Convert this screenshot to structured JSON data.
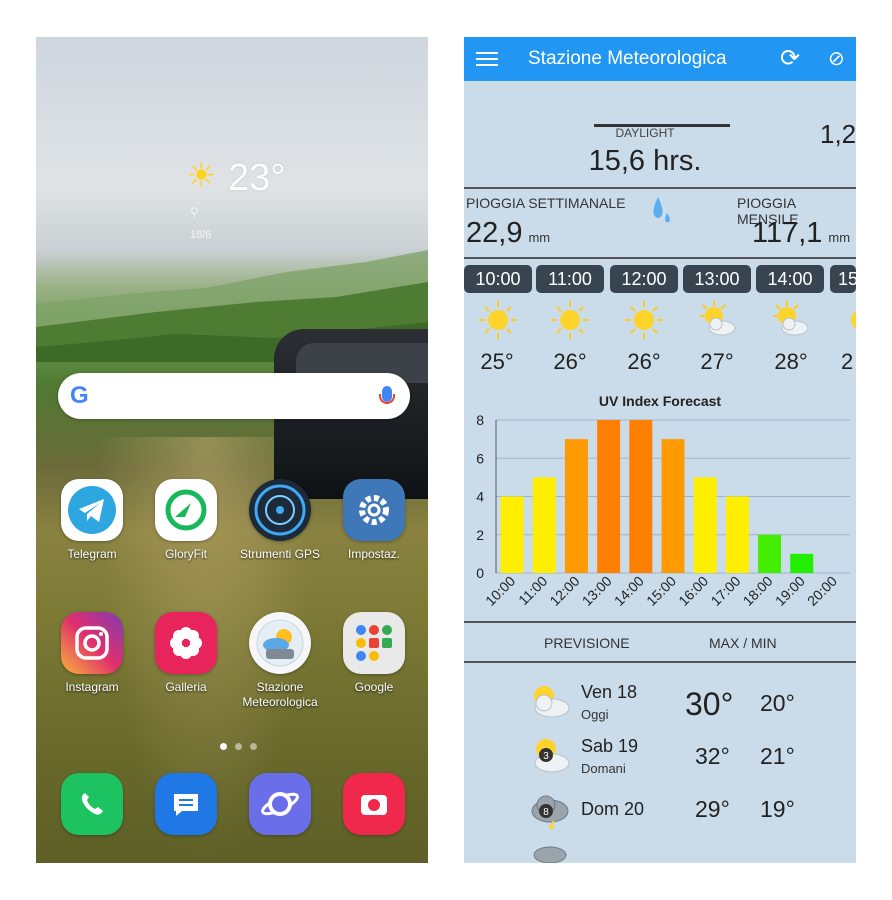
{
  "home": {
    "weather_widget": {
      "temperature": "23°",
      "date": "18/6"
    },
    "search": {
      "logo": "G"
    },
    "apps": [
      {
        "label": "Telegram",
        "icon": "telegram-icon",
        "color": "#2ea6e0"
      },
      {
        "label": "GloryFit",
        "icon": "gloryfit-icon",
        "color": "#ffffff"
      },
      {
        "label": "Strumenti GPS",
        "icon": "gps-tools-icon",
        "color": "#1c2a3a"
      },
      {
        "label": "Impostaz.",
        "icon": "settings-icon",
        "color": "#3f78b9"
      },
      {
        "label": "Instagram",
        "icon": "instagram-icon",
        "color": "#c13584"
      },
      {
        "label": "Galleria",
        "icon": "gallery-icon",
        "color": "#e8245c"
      },
      {
        "label": "Stazione Meteorologica",
        "icon": "weather-station-icon",
        "color": "#f4f6f8"
      },
      {
        "label": "Google",
        "icon": "google-folder-icon",
        "color": "#e9e9e9"
      }
    ],
    "dock": [
      {
        "icon": "phone-icon",
        "color": "#1ec361"
      },
      {
        "icon": "messages-icon",
        "color": "#1f78e6"
      },
      {
        "icon": "internet-icon",
        "color": "#6a6ee8"
      },
      {
        "icon": "camera-icon",
        "color": "#f0284c"
      }
    ]
  },
  "app": {
    "title": "Stazione Meteorologica",
    "daylight": {
      "label": "DAYLIGHT",
      "value": "15,6 hrs.",
      "clipped_value": "1,2"
    },
    "rain": {
      "weekly_label": "PIOGGIA SETTIMANALE",
      "weekly_value": "22,9",
      "unit": "mm",
      "monthly_label": "PIOGGIA MENSILE",
      "monthly_value": "117,1",
      "monthly_unit": "mm"
    },
    "hourly": [
      {
        "time": "10:00",
        "icon": "sun-icon",
        "temp": "25°"
      },
      {
        "time": "11:00",
        "icon": "sun-icon",
        "temp": "26°"
      },
      {
        "time": "12:00",
        "icon": "sun-icon",
        "temp": "26°"
      },
      {
        "time": "13:00",
        "icon": "partly-cloudy-icon",
        "temp": "27°"
      },
      {
        "time": "14:00",
        "icon": "partly-cloudy-icon",
        "temp": "28°"
      },
      {
        "time": "15",
        "icon": "sun-icon",
        "temp": "2"
      }
    ],
    "forecast_header": {
      "left": "PREVISIONE",
      "right": "MAX / MIN"
    },
    "forecast": [
      {
        "day": "Ven 18",
        "sub": "Oggi",
        "max": "30°",
        "min": "20°",
        "icon": "partly-cloudy-icon"
      },
      {
        "day": "Sab 19",
        "sub": "Domani",
        "max": "32°",
        "min": "21°",
        "icon": "partly-cloudy-uv-icon",
        "uv": "3"
      },
      {
        "day": "Dom 20",
        "sub": "",
        "max": "29°",
        "min": "19°",
        "icon": "storm-cloud-icon",
        "uv": "8"
      }
    ]
  },
  "chart_data": {
    "type": "bar",
    "title": "UV Index Forecast",
    "categories": [
      "10:00",
      "11:00",
      "12:00",
      "13:00",
      "14:00",
      "15:00",
      "16:00",
      "17:00",
      "18:00",
      "19:00",
      "20:00"
    ],
    "values": [
      4,
      5,
      7,
      8,
      8,
      7,
      5,
      4,
      2,
      1,
      0
    ],
    "colors": [
      "#ffee00",
      "#ffee00",
      "#ff9a00",
      "#ff7f00",
      "#ff7f00",
      "#ff9a00",
      "#ffee00",
      "#ffee00",
      "#44ee00",
      "#22ee00",
      "#22ee00"
    ],
    "ylim": [
      0,
      8
    ],
    "yticks": [
      "0",
      "2",
      "4",
      "6",
      "8"
    ],
    "grid": true
  }
}
